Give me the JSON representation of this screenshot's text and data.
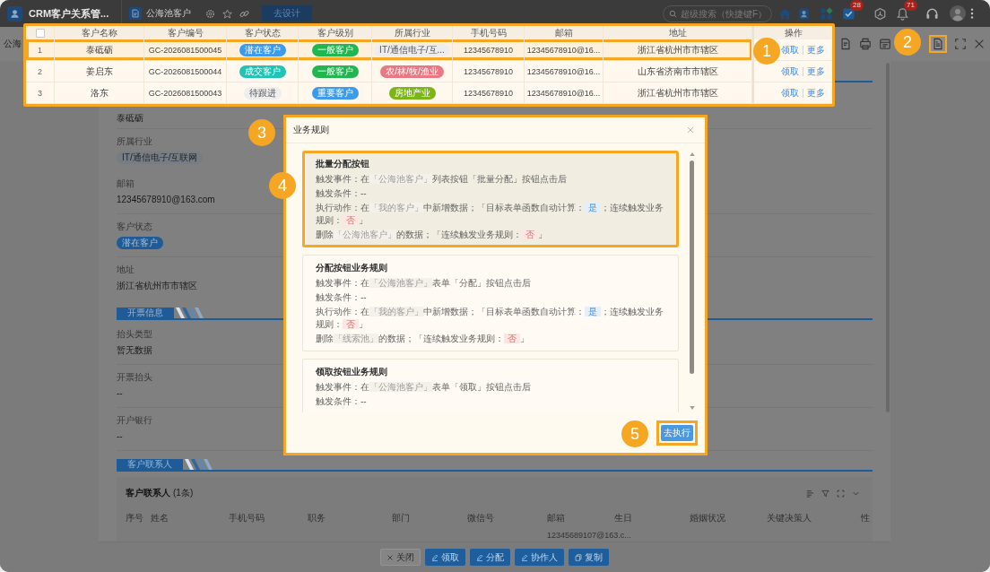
{
  "app_bar": {
    "title": "CRM客户关系管...",
    "page_tab": "公海池客户",
    "design_button": "去设计",
    "search": {
      "placeholder": "超级搜索（快捷键F）"
    },
    "task_badge": "28",
    "bell_badge": "71"
  },
  "table": {
    "header_checkbox": {
      "checked": false
    },
    "columns": [
      "客户名称",
      "客户编号",
      "客户状态",
      "客户级别",
      "所属行业",
      "手机号码",
      "邮箱",
      "地址",
      "操作"
    ],
    "rows": [
      {
        "index": "1",
        "highlighted": true,
        "name": "泰砥砺",
        "code": "GC-2026081500045",
        "status": {
          "text": "潜在客户",
          "color": "#3d9be9"
        },
        "grade": {
          "text": "一般客户",
          "color": "#21b650"
        },
        "industry": {
          "text": "IT/通信电子/互...",
          "color": "#ededed"
        },
        "phone": "12345678910",
        "email": "12345678910@16...",
        "address": "浙江省杭州市市辖区",
        "actions": [
          "领取",
          "更多"
        ]
      },
      {
        "index": "2",
        "highlighted": false,
        "name": "姜启东",
        "code": "GC-2026081500044",
        "status": {
          "text": "成交客户",
          "color": "#1fc4b4"
        },
        "grade": {
          "text": "一般客户",
          "color": "#21b650"
        },
        "industry": {
          "text": "农/林/牧/渔业",
          "color": "#ea7883"
        },
        "phone": "12345678910",
        "email": "12345678910@16...",
        "address": "山东省济南市市辖区",
        "actions": [
          "领取",
          "更多"
        ]
      },
      {
        "index": "3",
        "highlighted": false,
        "name": "洛东",
        "code": "GC-2026081500043",
        "status": {
          "text": "待跟进",
          "color": "#eeeeee"
        },
        "grade": {
          "text": "重要客户",
          "color": "#3d9be9"
        },
        "industry": {
          "text": "房地产业",
          "color": "#7cb518"
        },
        "phone": "12345678910",
        "email": "12345678910@16...",
        "address": "浙江省杭州市市辖区",
        "actions": [
          "领取",
          "更多"
        ]
      }
    ]
  },
  "drawer": {
    "title": "公海",
    "toolbar": [
      {
        "kind": "form",
        "highlighted": false
      },
      {
        "kind": "print",
        "highlighted": false
      },
      {
        "kind": "calendar",
        "highlighted": false
      },
      {
        "kind": "report",
        "highlighted": true
      },
      {
        "kind": "fullscreen",
        "highlighted": false
      },
      {
        "kind": "close",
        "highlighted": false
      }
    ]
  },
  "detail": {
    "fields": [
      {
        "kind": "text",
        "value": "泰砥砺"
      },
      {
        "label": "所属行业",
        "kind": "tag",
        "value": "IT/通信电子/互联网",
        "color": "#767d85"
      },
      {
        "label": "邮箱",
        "kind": "text",
        "value": "12345678910@163.com"
      },
      {
        "label": "客户状态",
        "kind": "tag",
        "value": "潜在客户",
        "color": "#1f5b96"
      },
      {
        "label": "地址",
        "kind": "text",
        "value": "浙江省杭州市市辖区"
      }
    ],
    "sections": [
      {
        "title": "开票信息",
        "fields": [
          {
            "label": "抬头类型",
            "kind": "text",
            "value": "暂无数据"
          },
          {
            "label": "开票抬头",
            "kind": "text",
            "value": "--"
          },
          {
            "label": "开户银行",
            "kind": "text",
            "value": "--"
          }
        ]
      }
    ]
  },
  "contacts": {
    "section_title": "客户联系人",
    "title": "客户联系人",
    "count": "(1条)",
    "columns": [
      "序号",
      "姓名",
      "手机号码",
      "职务",
      "部门",
      "微信号",
      "邮箱",
      "生日",
      "婚姻状况",
      "关键决策人",
      "性"
    ],
    "rows": [
      {
        "email": "12345689107@163.c..."
      }
    ]
  },
  "footer_buttons": [
    {
      "label": "关闭",
      "kind": "close"
    },
    {
      "label": "领取",
      "kind": "action"
    },
    {
      "label": "分配",
      "kind": "action"
    },
    {
      "label": "协作人",
      "kind": "action"
    },
    {
      "label": "复制",
      "kind": "copy"
    }
  ],
  "dialog": {
    "title": "业务规则",
    "rules": [
      {
        "title": "批量分配按钮",
        "highlighted": true,
        "lines": [
          [
            {
              "kind": "text",
              "text": "触发事件：在"
            },
            {
              "kind": "ref",
              "text": "「公海池客户」"
            },
            {
              "kind": "text",
              "text": "列表按钮「批量分配」按钮点击后"
            }
          ],
          [
            {
              "kind": "text",
              "text": "触发条件：--"
            }
          ],
          [
            {
              "kind": "text",
              "text": "执行动作：在"
            },
            {
              "kind": "ref",
              "text": "「我的客户」"
            },
            {
              "kind": "text",
              "text": "中新增数据；「目标表单函数自动计算："
            },
            {
              "kind": "yes",
              "text": "是"
            },
            {
              "kind": "text",
              "text": "；连续触发业务规则："
            },
            {
              "kind": "no",
              "text": "否"
            },
            {
              "kind": "text",
              "text": "」"
            }
          ],
          [
            {
              "kind": "text",
              "text": "删除"
            },
            {
              "kind": "ref",
              "text": "「公海池客户」"
            },
            {
              "kind": "text",
              "text": "的数据；「连续触发业务规则："
            },
            {
              "kind": "no",
              "text": "否"
            },
            {
              "kind": "text",
              "text": "」"
            }
          ]
        ]
      },
      {
        "title": "分配按钮业务规则",
        "highlighted": false,
        "lines": [
          [
            {
              "kind": "text",
              "text": "触发事件：在"
            },
            {
              "kind": "ref",
              "text": "「公海池客户」"
            },
            {
              "kind": "text",
              "text": "表单「分配」按钮点击后"
            }
          ],
          [
            {
              "kind": "text",
              "text": "触发条件：--"
            }
          ],
          [
            {
              "kind": "text",
              "text": "执行动作：在"
            },
            {
              "kind": "ref",
              "text": "「我的客户」"
            },
            {
              "kind": "text",
              "text": "中新增数据；「目标表单函数自动计算："
            },
            {
              "kind": "yes",
              "text": "是"
            },
            {
              "kind": "text",
              "text": "；连续触发业务规则："
            },
            {
              "kind": "no",
              "text": "否"
            },
            {
              "kind": "text",
              "text": "」"
            }
          ],
          [
            {
              "kind": "text",
              "text": "删除"
            },
            {
              "kind": "ref",
              "text": "「线索池」"
            },
            {
              "kind": "text",
              "text": "的数据；「连续触发业务规则："
            },
            {
              "kind": "no",
              "text": "否"
            },
            {
              "kind": "text",
              "text": "」"
            }
          ]
        ]
      },
      {
        "title": "领取按钮业务规则",
        "highlighted": false,
        "lines": [
          [
            {
              "kind": "text",
              "text": "触发事件：在"
            },
            {
              "kind": "ref",
              "text": "「公海池客户」"
            },
            {
              "kind": "text",
              "text": "表单「领取」按钮点击后"
            }
          ],
          [
            {
              "kind": "text",
              "text": "触发条件：--"
            }
          ]
        ]
      }
    ],
    "buttons": [
      {
        "label": "去执行",
        "highlighted": true
      }
    ]
  },
  "callouts": [
    {
      "label": "1"
    },
    {
      "label": "2"
    },
    {
      "label": "3"
    },
    {
      "label": "4"
    },
    {
      "label": "5"
    }
  ]
}
